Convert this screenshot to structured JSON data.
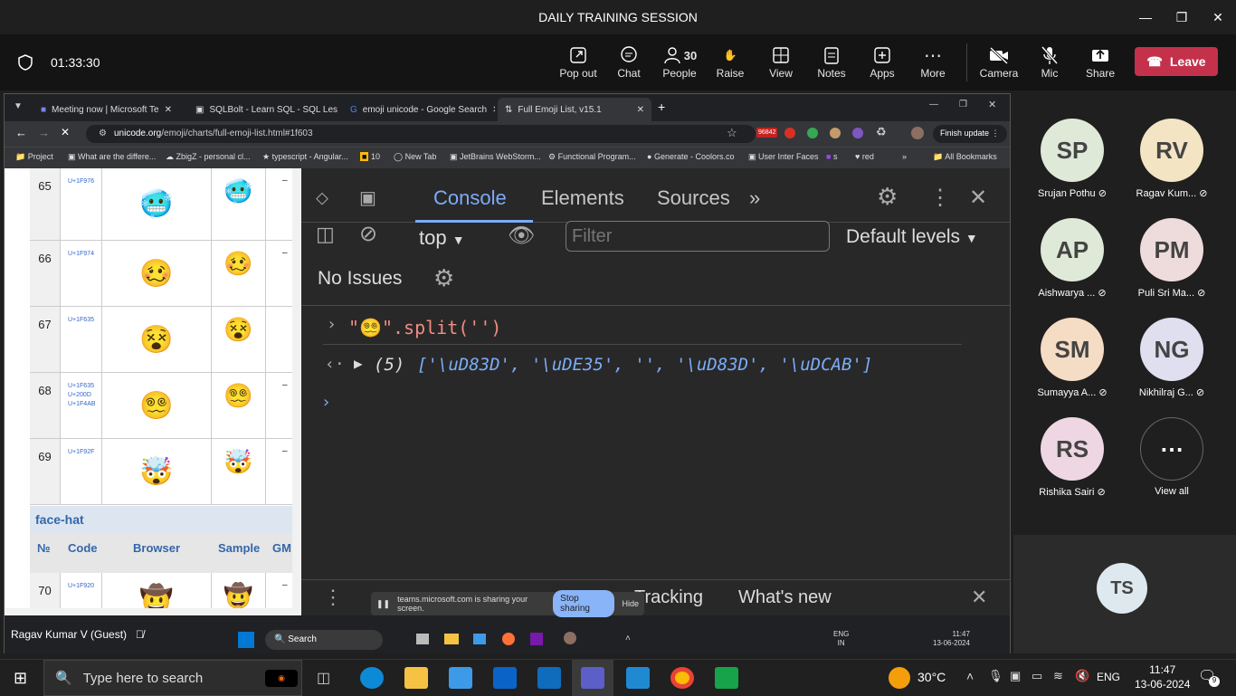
{
  "teams": {
    "title": "DAILY TRAINING SESSION",
    "timer": "01:33:30",
    "buttons": {
      "popout": "Pop out",
      "chat": "Chat",
      "people": "People",
      "people_count": "30",
      "raise": "Raise",
      "view": "View",
      "notes": "Notes",
      "apps": "Apps",
      "more": "More",
      "camera": "Camera",
      "mic": "Mic",
      "share": "Share",
      "leave": "Leave"
    }
  },
  "chrome": {
    "tabs": [
      "Meeting now | Microsoft Te",
      "SQLBolt - Learn SQL - SQL Less",
      "emoji unicode - Google Search",
      "Full Emoji List, v15.1"
    ],
    "url_host": "unicode.org",
    "url_path": "/emoji/charts/full-emoji-list.html#1f603",
    "finish_update": "Finish update",
    "notif_badge": "96842",
    "bookmarks": [
      "Project",
      "What are the differe...",
      "ZbigZ - personal cl...",
      "typescript - Angular...",
      "10",
      "New Tab",
      "JetBrains WebStorm...",
      "Functional Program...",
      "Generate - Coolors.co",
      "User Inter Faces",
      "s",
      "red",
      "All Bookmarks"
    ]
  },
  "emoji_table": {
    "rows": [
      {
        "num": "65",
        "code": [
          "U+1F976"
        ],
        "browser": "🥶",
        "sample": "🥶"
      },
      {
        "num": "66",
        "code": [
          "U+1F974"
        ],
        "browser": "🥴",
        "sample": "🥴"
      },
      {
        "num": "67",
        "code": [
          "U+1F635"
        ],
        "browser": "😵",
        "sample": "😵"
      },
      {
        "num": "68",
        "code": [
          "U+1F635",
          "U+200D",
          "U+1F4AB"
        ],
        "browser": "😵‍💫",
        "sample": "😵‍💫"
      },
      {
        "num": "69",
        "code": [
          "U+1F92F"
        ],
        "browser": "🤯",
        "sample": "🤯"
      },
      {
        "num": "70",
        "code": [
          "U+1F920"
        ],
        "browser": "🤠",
        "sample": "🤠"
      }
    ],
    "section": "face-hat",
    "headers": [
      "№",
      "Code",
      "Browser",
      "Sample",
      "GM"
    ]
  },
  "devtools": {
    "tabs": [
      "Console",
      "Elements",
      "Sources"
    ],
    "context": "top",
    "filter_placeholder": "Filter",
    "levels": "Default levels",
    "issues": "No Issues",
    "input_line": "\"😵‍💫\".split('')",
    "result_count": "(5)",
    "result_items": "['\\uD83D', '\\uDE35', '', '\\uD83D', '\\uDCAB']",
    "bottom_tabs": [
      "Tracking",
      "What's new"
    ]
  },
  "sharebar": {
    "text": "teams.microsoft.com is sharing your screen.",
    "stop": "Stop sharing",
    "hide": "Hide"
  },
  "inner_taskbar": {
    "search": "Search",
    "lang": "ENG",
    "lang2": "IN",
    "time": "11:47",
    "date": "13-06-2024"
  },
  "presenter": "Ragav Kumar V (Guest)",
  "participants": [
    {
      "initials": "SP",
      "name": "Srujan Pothu",
      "color": "#dfe9d8"
    },
    {
      "initials": "RV",
      "name": "Ragav Kum...",
      "color": "#f3e4c4"
    },
    {
      "initials": "AP",
      "name": "Aishwarya ...",
      "color": "#dfe9d8"
    },
    {
      "initials": "PM",
      "name": "Puli Sri Ma...",
      "color": "#eedcdc"
    },
    {
      "initials": "SM",
      "name": "Sumayya A...",
      "color": "#f5dcc4"
    },
    {
      "initials": "NG",
      "name": "Nikhilraj G...",
      "color": "#e0dff0"
    },
    {
      "initials": "RS",
      "name": "Rishika Sairi",
      "color": "#eed7e2"
    }
  ],
  "view_all": "View all",
  "self_initials": "TS",
  "taskbar": {
    "search": "Type here to search",
    "weather": "30°C",
    "lang": "ENG",
    "time": "11:47",
    "date": "13-06-2024",
    "notif": "9"
  }
}
